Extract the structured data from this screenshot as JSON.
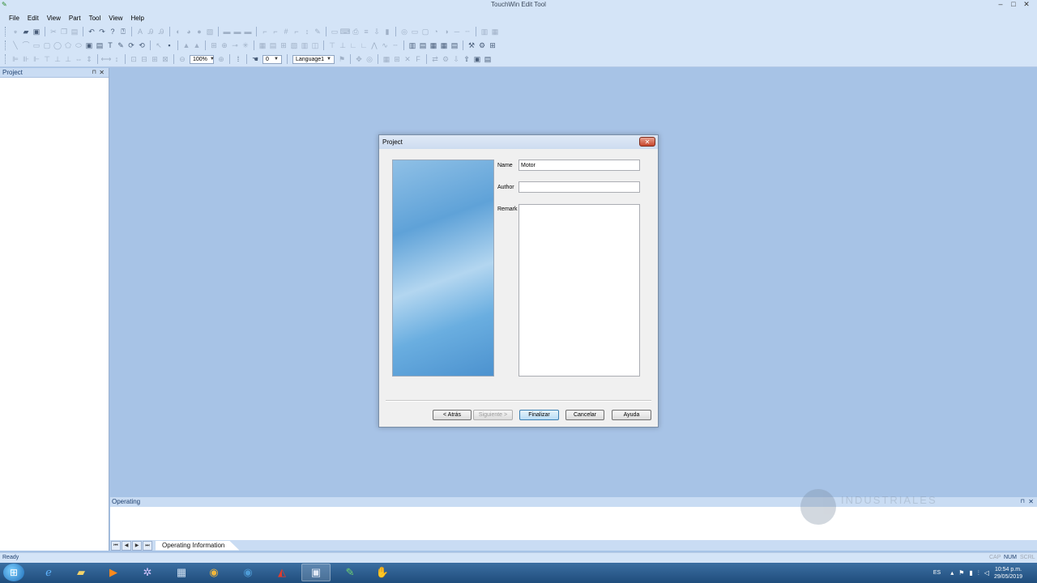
{
  "window": {
    "title": "TouchWin Edit Tool",
    "controls": [
      "–",
      "□",
      "✕"
    ]
  },
  "menu": [
    "File",
    "Edit",
    "View",
    "Part",
    "Tool",
    "View",
    "Help"
  ],
  "toolbar3": {
    "zoom": "100%",
    "layer": "0",
    "language": "Language1"
  },
  "project_panel": {
    "title": "Project",
    "pin": "⊓",
    "close": "✕"
  },
  "operating_panel": {
    "title": "Operating",
    "tab": "Operating Information",
    "pin": "⊓",
    "close": "✕"
  },
  "status": {
    "ready": "Ready",
    "cap": "CAP",
    "num": "NUM",
    "scrl": "SCRL"
  },
  "dialog": {
    "title": "Project",
    "fields": {
      "name_label": "Name",
      "name_value": "Motor",
      "author_label": "Author",
      "author_value": "",
      "remark_label": "Remark",
      "remark_value": ""
    },
    "buttons": {
      "back": "< Atrás",
      "next": "Siguiente >",
      "finish": "Finalizar",
      "cancel": "Cancelar",
      "help": "Ayuda"
    }
  },
  "watermark": {
    "text": "INDUSTRIALES"
  },
  "taskbar": {
    "lang": "ES",
    "time": "10:54 p.m.",
    "date": "29/05/2019"
  },
  "colors": {
    "desktop": "#a7c3e6",
    "chrome": "#d4e4f7",
    "taskbar": "#2a5a8c"
  }
}
